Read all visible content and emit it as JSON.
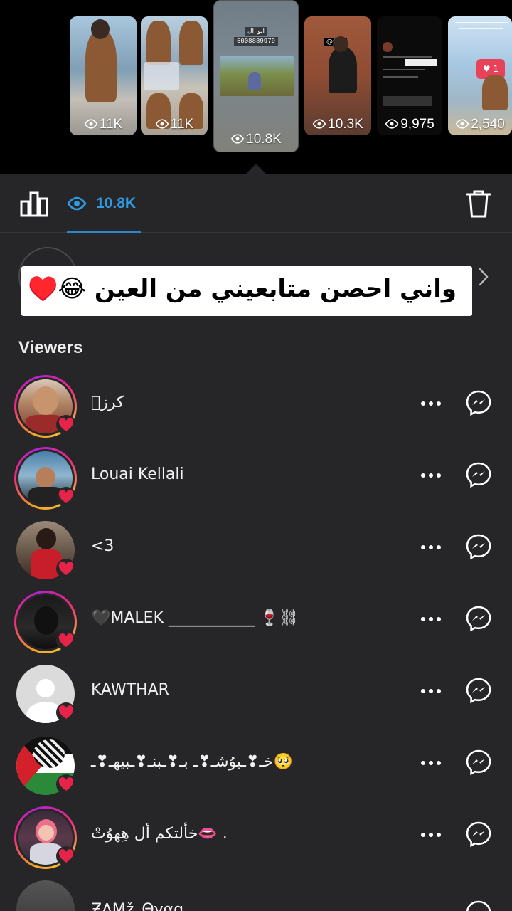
{
  "story_strip": {
    "thumbnails": [
      {
        "views": "11K"
      },
      {
        "views": "11K"
      },
      {
        "views": "10.8K",
        "overlay_user": "ابو ال",
        "overlay_number": "5008889979"
      },
      {
        "views": "10.3K",
        "overlay_label": "@078"
      },
      {
        "views": "9,975"
      },
      {
        "views": "2,540",
        "like_count": "1"
      }
    ]
  },
  "toolbar": {
    "view_count": "10.8K"
  },
  "caption": {
    "text": "واني احصن متابعيني من العين 😂♥️"
  },
  "viewers": {
    "title": "Viewers",
    "items": [
      {
        "name": "كرزۧ",
        "ring": true,
        "liked": true
      },
      {
        "name": "Louai Kellali",
        "ring": true,
        "liked": true
      },
      {
        "name": "<3",
        "ring": false,
        "liked": true
      },
      {
        "name": "🖤MALEK ___________ 🍷⛓",
        "ring": true,
        "liked": true
      },
      {
        "name": "KAWTHAR",
        "ring": false,
        "liked": true
      },
      {
        "name": "خـ❣ـبوُشـ❣ـ بـ❣ـبنـ❣ـبيهـ❣ـ🥺",
        "ring": false,
        "liked": true
      },
      {
        "name": "خألتكم أل هِهوُتْ👄 .",
        "ring": true,
        "liked": true
      },
      {
        "name": "Ƶ∆Mž_Θγαg",
        "ring": false,
        "liked": false
      }
    ]
  },
  "colors": {
    "accent_blue": "#2f9ae2",
    "heart_red": "#e8234a",
    "sheet_bg": "#262628"
  }
}
